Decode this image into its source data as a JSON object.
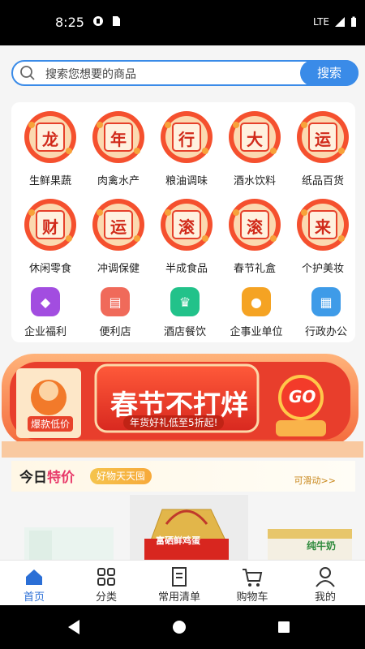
{
  "status": {
    "time": "8:25",
    "network": "LTE"
  },
  "search": {
    "placeholder": "搜索您想要的商品",
    "button": "搜索"
  },
  "categories": [
    {
      "badge": "龙",
      "label": "生鲜果蔬"
    },
    {
      "badge": "年",
      "label": "肉禽水产"
    },
    {
      "badge": "行",
      "label": "粮油调味"
    },
    {
      "badge": "大",
      "label": "酒水饮料"
    },
    {
      "badge": "运",
      "label": "纸品百货"
    },
    {
      "badge": "财",
      "label": "休闲零食"
    },
    {
      "badge": "运",
      "label": "冲调保健"
    },
    {
      "badge": "滚",
      "label": "半成食品"
    },
    {
      "badge": "滚",
      "label": "春节礼盒"
    },
    {
      "badge": "来",
      "label": "个护美妆"
    }
  ],
  "services": [
    {
      "label": "企业福利",
      "color": "#a24de0"
    },
    {
      "label": "便利店",
      "color": "#f06a5a"
    },
    {
      "label": "酒店餐饮",
      "color": "#22c28a"
    },
    {
      "label": "企事业单位",
      "color": "#f5a323"
    },
    {
      "label": "行政办公",
      "color": "#3e9be8"
    }
  ],
  "banner": {
    "title": "春节不打烊",
    "subtitle": "年货好礼低至5折起!",
    "tag": "爆款低价",
    "go": "GO"
  },
  "today": {
    "title_black": "今日",
    "title_red": "特价",
    "pill": "好物天天囤",
    "slide": "可滑动>>"
  },
  "products": [
    {
      "label": "纯牛奶"
    },
    {
      "label": "富硒鲜鸡蛋"
    }
  ],
  "tabs": [
    {
      "label": "首页",
      "icon": "home-icon",
      "active": true
    },
    {
      "label": "分类",
      "icon": "grid-icon"
    },
    {
      "label": "常用清单",
      "icon": "list-icon"
    },
    {
      "label": "购物车",
      "icon": "cart-icon"
    },
    {
      "label": "我的",
      "icon": "user-icon"
    }
  ]
}
